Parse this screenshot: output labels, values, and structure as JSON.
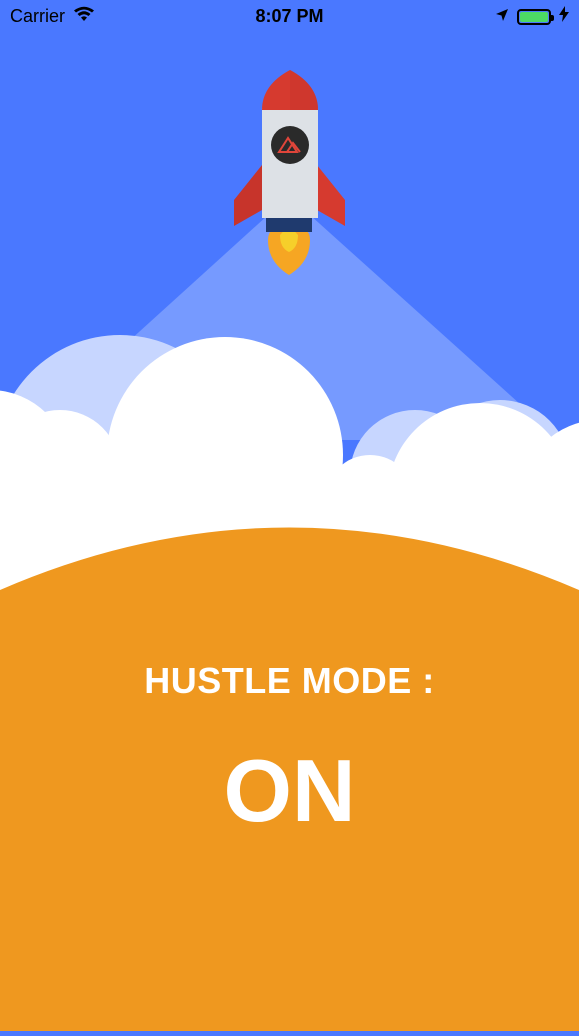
{
  "status_bar": {
    "carrier": "Carrier",
    "time": "8:07 PM",
    "icons": [
      "wifi-icon",
      "location-arrow-icon",
      "battery-icon",
      "charging-bolt-icon"
    ]
  },
  "hero": {
    "illustration": "rocket-launch-illustration",
    "rocket_emblem": "mountain-icon"
  },
  "main": {
    "label": "HUSTLE MODE :",
    "value": "ON"
  },
  "colors": {
    "sky": "#4a78ff",
    "beam": "#7ea0ff",
    "cloud_back": "#c7d6ff",
    "cloud_front": "#ffffff",
    "ground": "#ef981f",
    "rocket_red": "#d63a2f",
    "rocket_body": "#dde1e6",
    "flame": "#f6a623",
    "text": "#ffffff"
  }
}
